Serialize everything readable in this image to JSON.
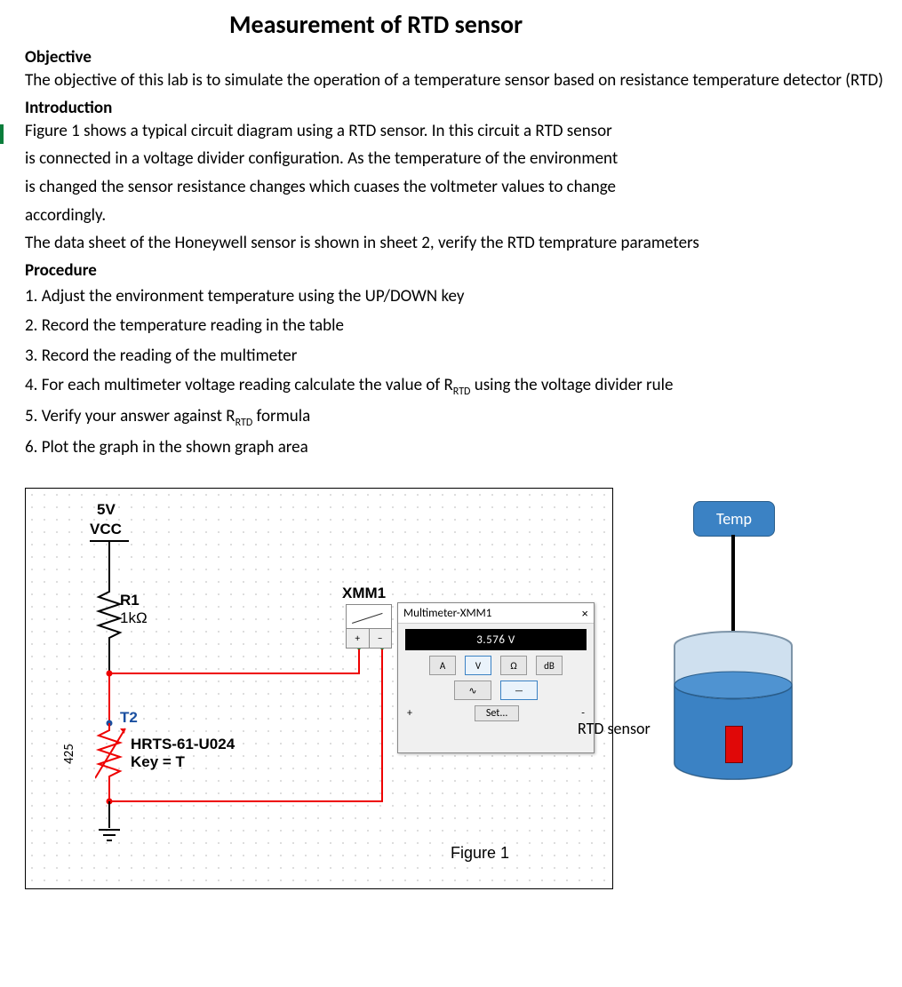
{
  "title": "Measurement of RTD sensor",
  "sections": {
    "objective": {
      "heading": "Objective",
      "text": "The objective of this lab is to simulate the operation of a temperature sensor based on resistance temperature detector (RTD)"
    },
    "intro": {
      "heading": "Introduction",
      "l1": "Figure 1 shows a typical circuit diagram using a RTD sensor.  In this circuit a RTD sensor",
      "l2": "is connected in a voltage divider configuration.  As the temperature of the environment",
      "l3": "is changed the sensor resistance changes which cuases the voltmeter values to change",
      "l4": "accordingly.",
      "l5": "The data sheet of the Honeywell sensor is shown in sheet 2, verify the RTD temprature parameters"
    },
    "proc": {
      "heading": "Procedure",
      "items": [
        "1. Adjust the environment temperature using the UP/DOWN key",
        "2. Record the temperature reading in the table",
        "3. Record the reading of the multimeter",
        "4. For each multimeter voltage reading calculate the value of R___RTD___ using the voltage divider rule",
        "5. Verify your answer against R___RTD___ formula",
        "6. Plot the graph in the shown graph area"
      ]
    }
  },
  "circuit": {
    "supply": "5V",
    "vcc": "VCC",
    "r1": {
      "ref": "R1",
      "value": "1kΩ"
    },
    "t2": {
      "ref": "T2",
      "part": "HRTS-61-U024",
      "key": "Key = T"
    },
    "side_value": "425",
    "meter": {
      "ref": "XMM1",
      "title": "Multimeter-XMM1",
      "reading": "3.576 V",
      "buttons": {
        "a": "A",
        "v": "V",
        "ohm": "Ω",
        "db": "dB",
        "ac": "∿",
        "dc": "—"
      },
      "set": "Set...",
      "plus": "+",
      "minus": "-"
    },
    "figcap": "Figure 1"
  },
  "temp": {
    "button": "Temp",
    "label": "RTD sensor"
  }
}
